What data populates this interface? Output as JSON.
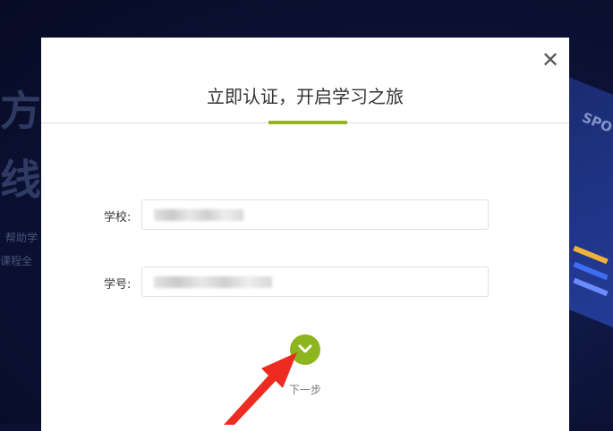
{
  "background": {
    "title_line_1": "方",
    "title_line_2": "线",
    "sub_line_1": "帮助学",
    "sub_line_2": "课程全",
    "deco_label": "SPO"
  },
  "modal": {
    "title": "立即认证，开启学习之旅",
    "close_icon": "close-icon",
    "fields": [
      {
        "label": "学校:",
        "value": "",
        "placeholder": ""
      },
      {
        "label": "学号:",
        "value": "",
        "placeholder": ""
      }
    ],
    "next_button": {
      "icon": "chevron-down-icon",
      "label": "下一步"
    }
  },
  "colors": {
    "accent": "#95b321",
    "button": "#8db51d",
    "annotation_arrow": "#ee2b20"
  }
}
